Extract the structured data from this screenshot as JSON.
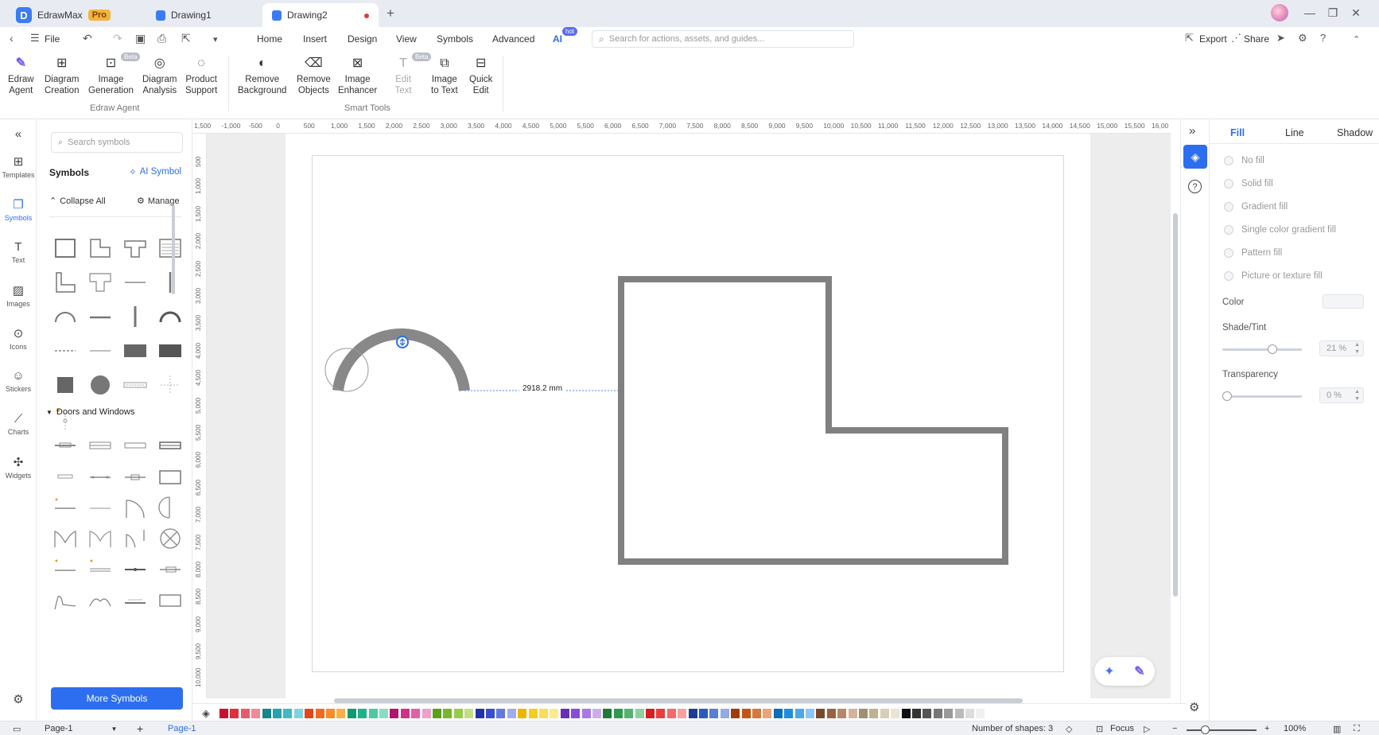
{
  "window": {
    "app_name": "EdrawMax",
    "pro_badge": "Pro",
    "tabs": [
      {
        "label": "Drawing1",
        "active": false
      },
      {
        "label": "Drawing2",
        "active": true
      }
    ],
    "new_tab": "+"
  },
  "menubar": {
    "file": "File",
    "items": [
      "Home",
      "Insert",
      "Design",
      "View",
      "Symbols",
      "Advanced",
      "AI"
    ],
    "ai_badge": "hot",
    "search_placeholder": "Search for actions, assets, and guides...",
    "export": "Export",
    "share": "Share"
  },
  "ribbon": {
    "groups": [
      {
        "label": "Edraw Agent",
        "buttons": [
          {
            "line1": "Edraw",
            "line2": "Agent"
          },
          {
            "line1": "Diagram",
            "line2": "Creation"
          },
          {
            "line1": "Image",
            "line2": "Generation",
            "badge": "Beta"
          },
          {
            "line1": "Diagram",
            "line2": "Analysis"
          },
          {
            "line1": "Product",
            "line2": "Support"
          }
        ]
      },
      {
        "label": "Smart Tools",
        "buttons": [
          {
            "line1": "Remove",
            "line2": "Background"
          },
          {
            "line1": "Remove",
            "line2": "Objects"
          },
          {
            "line1": "Image",
            "line2": "Enhancer"
          },
          {
            "line1": "Edit",
            "line2": "Text",
            "badge": "Beta",
            "disabled": true
          },
          {
            "line1": "Image",
            "line2": "to Text"
          },
          {
            "line1": "Quick",
            "line2": "Edit"
          }
        ]
      }
    ]
  },
  "leftnav": {
    "items": [
      {
        "label": "Templates",
        "icon": "templates-icon"
      },
      {
        "label": "Symbols",
        "icon": "symbols-icon",
        "active": true
      },
      {
        "label": "Text",
        "icon": "text-icon"
      },
      {
        "label": "Images",
        "icon": "images-icon"
      },
      {
        "label": "Icons",
        "icon": "icons-icon"
      },
      {
        "label": "Stickers",
        "icon": "stickers-icon"
      },
      {
        "label": "Charts",
        "icon": "charts-icon"
      },
      {
        "label": "Widgets",
        "icon": "widgets-icon"
      }
    ]
  },
  "symbols_panel": {
    "search_placeholder": "Search symbols",
    "title": "Symbols",
    "ai_symbol": "AI Symbol",
    "collapse_all": "Collapse All",
    "manage": "Manage",
    "section_doors": "Doors and Windows",
    "more_symbols": "More Symbols"
  },
  "ruler": {
    "h_labels": [
      "1,500",
      "-1,000",
      "-500",
      "0",
      "500",
      "1,000",
      "1,500",
      "2,000",
      "2,500",
      "3,000",
      "3,500",
      "4,000",
      "4,500",
      "5,000",
      "5,500",
      "6,000",
      "6,500",
      "7,000",
      "7,500",
      "8,000",
      "8,500",
      "9,000",
      "9,500",
      "10,000",
      "10,500",
      "11,000",
      "11,500",
      "12,000",
      "12,500",
      "13,000",
      "13,500",
      "14,000",
      "14,500",
      "15,000",
      "15,500",
      "16,00"
    ],
    "v_labels": [
      "500",
      "1,000",
      "1,500",
      "2,000",
      "2,500",
      "3,000",
      "3,500",
      "4,000",
      "4,500",
      "5,000",
      "5,500",
      "6,000",
      "6,500",
      "7,000",
      "7,500",
      "8,000",
      "8,500",
      "9,000",
      "9,500",
      "10,000"
    ]
  },
  "canvas": {
    "dimension_label": "2918.2 mm"
  },
  "format_panel": {
    "tabs": [
      "Fill",
      "Line",
      "Shadow"
    ],
    "active_tab": "Fill",
    "fill_options": [
      "No fill",
      "Solid fill",
      "Gradient fill",
      "Single color gradient fill",
      "Pattern fill",
      "Picture or texture fill"
    ],
    "color_label": "Color",
    "shade_label": "Shade/Tint",
    "shade_value": "21 %",
    "shade_fraction": 0.21,
    "transparency_label": "Transparency",
    "transparency_value": "0 %",
    "transparency_fraction": 0
  },
  "color_palette": [
    "#c8102e",
    "#e0303c",
    "#e85a6a",
    "#f08a9a",
    "#16868f",
    "#24a3b0",
    "#3fbac8",
    "#7fd3de",
    "#e8461a",
    "#f26a1f",
    "#f78b2e",
    "#fbae47",
    "#0f9a70",
    "#1db38a",
    "#4ccaa3",
    "#8addc4",
    "#b3126e",
    "#d0308a",
    "#e060a8",
    "#eea0cb",
    "#5aa117",
    "#76b82a",
    "#98cb4a",
    "#c0df86",
    "#2233a8",
    "#3a4fd0",
    "#6577e0",
    "#a0acef",
    "#f0b400",
    "#f7cc1f",
    "#fbdc5a",
    "#fde98f",
    "#6b2bb8",
    "#8a4bd6",
    "#aa7ae4",
    "#cbaeef",
    "#1e7a3a",
    "#2e9a4e",
    "#52b46e",
    "#8fd0a0",
    "#d81e1e",
    "#ee3c3c",
    "#f26a6a",
    "#f7a0a0",
    "#1c3f94",
    "#2d58c0",
    "#5a7ed6",
    "#94abe6",
    "#a33a0b",
    "#c45416",
    "#d9763e",
    "#e8a47e",
    "#0a6fb8",
    "#1f8ede",
    "#4aa9ea",
    "#89c8f2",
    "#7a4a2a",
    "#9a6240",
    "#b8876a",
    "#d4b29c",
    "#a09070",
    "#bfb092",
    "#d8cdb5",
    "#ebe4d5",
    "#111111",
    "#333333",
    "#555555",
    "#777777",
    "#999999",
    "#bbbbbb",
    "#dddddd",
    "#f0f0f0"
  ],
  "statusbar": {
    "page_select": "Page-1",
    "add_page": "+",
    "page_tab": "Page-1",
    "shapes_count": "Number of shapes: 3",
    "focus": "Focus",
    "zoom": "100%"
  }
}
